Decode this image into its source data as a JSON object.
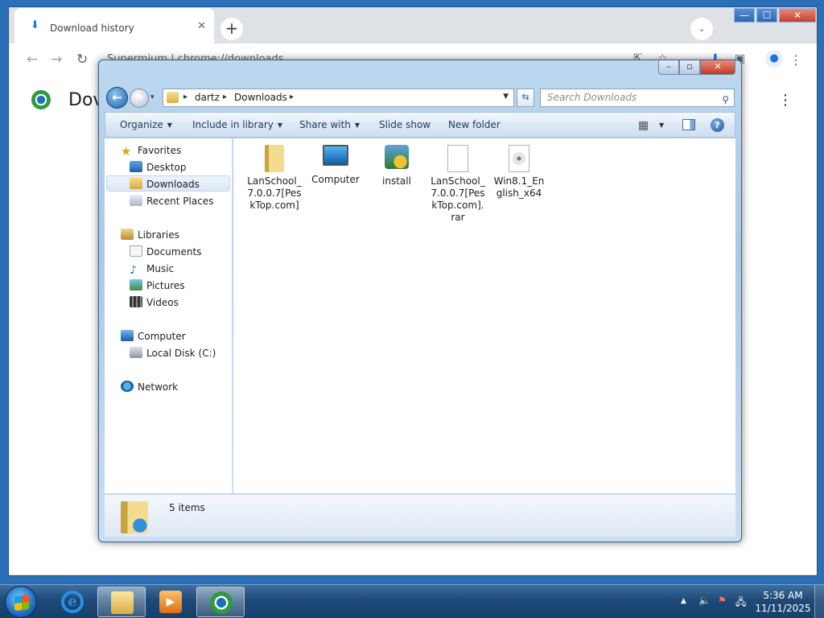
{
  "chrome": {
    "tab_title": "Download history",
    "tab_close": "✕",
    "new_tab": "+",
    "tab_search": "⌄",
    "min": "—",
    "max": "☐",
    "close": "✕",
    "back": "←",
    "forward": "→",
    "reload": "↻",
    "omnibox": "Supermium  |  chrome://downloads",
    "page_heading": "Dov",
    "menu": "⋮",
    "toolbar_menu": "⋮",
    "avatar": "●"
  },
  "explorer": {
    "title_min": "–",
    "title_max": "▫",
    "title_close": "✕",
    "back": "←",
    "forward": "→",
    "history_caret": "▾",
    "breadcrumb": [
      "dartz",
      "Downloads"
    ],
    "breadcrumb_sep": "▸",
    "address_dropdown": "▼",
    "refresh": "⇆",
    "search_placeholder": "Search Downloads",
    "search_icon": "⚲",
    "commands": {
      "organize": "Organize",
      "include_in_library": "Include in library",
      "share_with": "Share with",
      "slide_show": "Slide show",
      "new_folder": "New folder"
    },
    "caret": "▼",
    "views_icon": "▦",
    "help": "?",
    "nav": {
      "favorites": "Favorites",
      "desktop": "Desktop",
      "downloads": "Downloads",
      "recent_places": "Recent Places",
      "libraries": "Libraries",
      "documents": "Documents",
      "music": "Music",
      "pictures": "Pictures",
      "videos": "Videos",
      "computer": "Computer",
      "local_disk": "Local Disk (C:)",
      "network": "Network"
    },
    "files": [
      {
        "name": "LanSchool_7.0.0.7[PeskTop.com]",
        "icon": "zip-folder-icon"
      },
      {
        "name": "Computer",
        "icon": "computer-shortcut-icon"
      },
      {
        "name": "install",
        "icon": "installer-icon"
      },
      {
        "name": "LanSchool_7.0.0.7[PeskTop.com].rar",
        "icon": "blank-file-icon"
      },
      {
        "name": "Win8.1_English_x64",
        "icon": "disc-image-icon"
      }
    ],
    "item_count": "5 items"
  },
  "taskbar": {
    "ie_glyph": "e",
    "media_glyph": "▶",
    "tray_show_hidden": "▲",
    "tray_volume": "🔈",
    "tray_flag": "⚑",
    "tray_network": "🖧",
    "time": "5:36 AM",
    "date": "11/11/2025"
  }
}
